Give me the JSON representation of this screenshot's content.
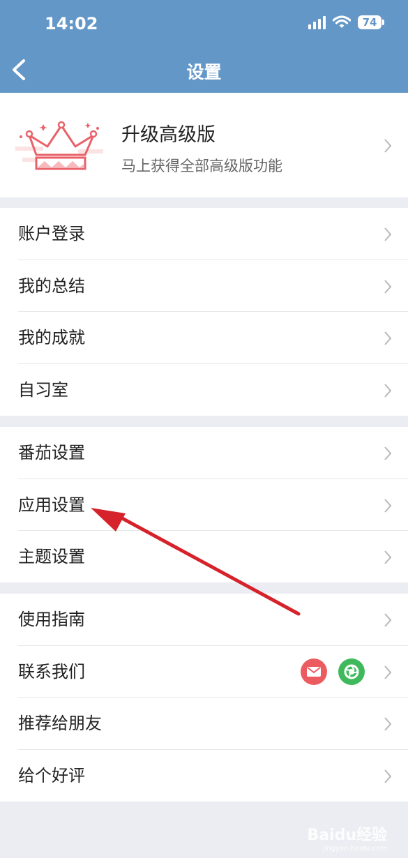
{
  "status": {
    "time": "14:02",
    "battery": "74"
  },
  "nav": {
    "title": "设置"
  },
  "premium": {
    "title": "升级高级版",
    "subtitle": "马上获得全部高级版功能"
  },
  "group1": [
    {
      "label": "账户登录"
    },
    {
      "label": "我的总结"
    },
    {
      "label": "我的成就"
    },
    {
      "label": "自习室"
    }
  ],
  "group2": [
    {
      "label": "番茄设置"
    },
    {
      "label": "应用设置"
    },
    {
      "label": "主题设置"
    }
  ],
  "group3": [
    {
      "label": "使用指南"
    },
    {
      "label": "联系我们"
    },
    {
      "label": "推荐给朋友"
    },
    {
      "label": "给个好评"
    }
  ],
  "watermark": {
    "brand": "Baidu经验",
    "url": "jingyan.baidu.com"
  },
  "colors": {
    "header": "#6397c8",
    "background": "#ecedf2",
    "crown": "#e8626a",
    "arrow": "#d6222a"
  },
  "icons": {
    "back": "chevron-left-icon",
    "row": "chevron-right-icon",
    "mail": "mail-icon",
    "camera": "camera-aperture-icon"
  }
}
